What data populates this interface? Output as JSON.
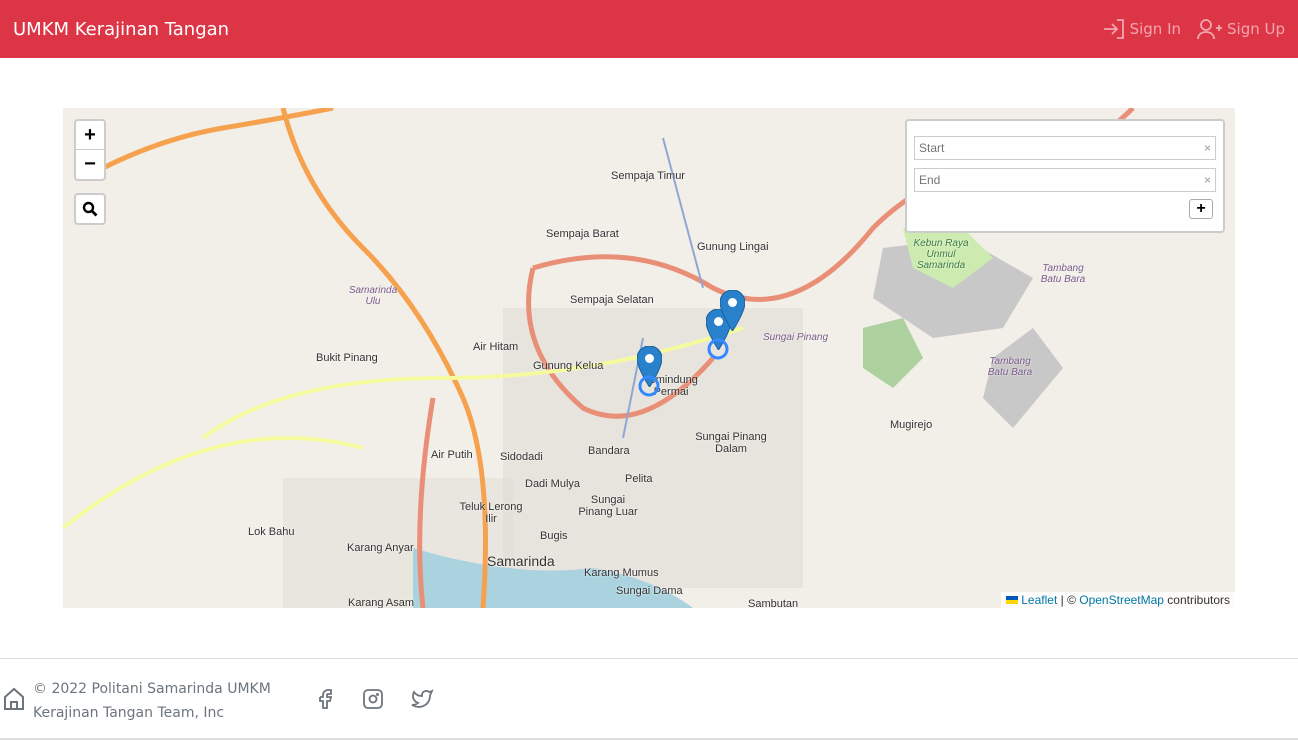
{
  "nav": {
    "brand": "UMKM Kerajinan Tangan",
    "sign_in": "Sign In",
    "sign_up": "Sign Up"
  },
  "map": {
    "zoom_in": "+",
    "zoom_out": "−",
    "routing": {
      "start_placeholder": "Start",
      "end_placeholder": "End",
      "add": "+",
      "clear": "×"
    },
    "attribution": {
      "leaflet": "Leaflet",
      "sep": " | © ",
      "osm": "OpenStreetMap",
      "suffix": " contributors"
    },
    "labels": [
      "Sempaja Timur",
      "Sempaja Barat",
      "Gunung Lingai",
      "Sempaja Selatan",
      "Air Hitam",
      "Gunung Kelua",
      "Temindung Permai",
      "Bukit Pinang",
      "Sungai Pinang",
      "Air Putih",
      "Sidodadi",
      "Bandara",
      "Sungai Pinang Dalam",
      "Dadi Mulya",
      "Pelita",
      "Teluk Lerong Ilir",
      "Sungai Pinang Luar",
      "Lok Bahu",
      "Karang Anyar",
      "Bugis",
      "Samarinda",
      "Karang Mumus",
      "Sungai Dama",
      "Karang Asam",
      "Sambutan",
      "Mugirejo",
      "Tambang Batu Bara",
      "Tambang Batu Bara",
      "Kebun Raya Unmul Samarinda",
      "Samarinda Ulu"
    ]
  },
  "footer": {
    "copyright_line1": "© 2022 Politani Samarinda UMKM",
    "copyright_line2": "Kerajinan Tangan Team, Inc"
  }
}
